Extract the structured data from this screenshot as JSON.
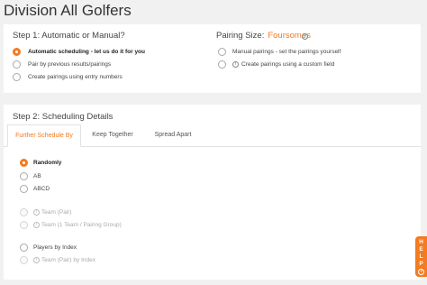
{
  "page_title": "Division All Golfers",
  "step1": {
    "title": "Step 1: Automatic or Manual?",
    "options": [
      {
        "label": "Automatic scheduling - let us do it for you",
        "selected": true
      },
      {
        "label": "Pair by previous results/pairings",
        "selected": false
      },
      {
        "label": "Create pairings using entry numbers",
        "selected": false
      }
    ]
  },
  "pairing": {
    "label": "Pairing Size:",
    "value": "Foursomes",
    "info_icon": "info-icon",
    "options": [
      {
        "label": "Manual pairings - set the pairings yourself",
        "selected": false
      },
      {
        "label": "Create pairings using a custom field",
        "selected": false,
        "icon": "info-icon"
      }
    ]
  },
  "step2": {
    "title": "Step 2: Scheduling Details",
    "tabs": [
      {
        "label": "Further Schedule By",
        "active": true
      },
      {
        "label": "Keep Together",
        "active": false
      },
      {
        "label": "Spread Apart",
        "active": false
      }
    ],
    "options": [
      {
        "label": "Randomly",
        "selected": true,
        "disabled": false
      },
      {
        "label": "AB",
        "selected": false,
        "disabled": false
      },
      {
        "label": "ABCD",
        "selected": false,
        "disabled": false
      },
      {
        "label": "Team (Pair)",
        "selected": false,
        "disabled": true,
        "icon": "info-icon"
      },
      {
        "label": "Team (1 Team / Pairing Group)",
        "selected": false,
        "disabled": true,
        "icon": "info-icon"
      },
      {
        "label": "Players by Index",
        "selected": false,
        "disabled": false
      },
      {
        "label": "Team (Pair) by Index",
        "selected": false,
        "disabled": true,
        "icon": "info-icon"
      }
    ]
  },
  "help": {
    "letters": [
      "H",
      "E",
      "L",
      "P"
    ],
    "icon": "question-icon",
    "icon_glyph": "?"
  },
  "colors": {
    "accent": "#f47b20",
    "background": "#f1f1f1",
    "card": "#ffffff"
  }
}
